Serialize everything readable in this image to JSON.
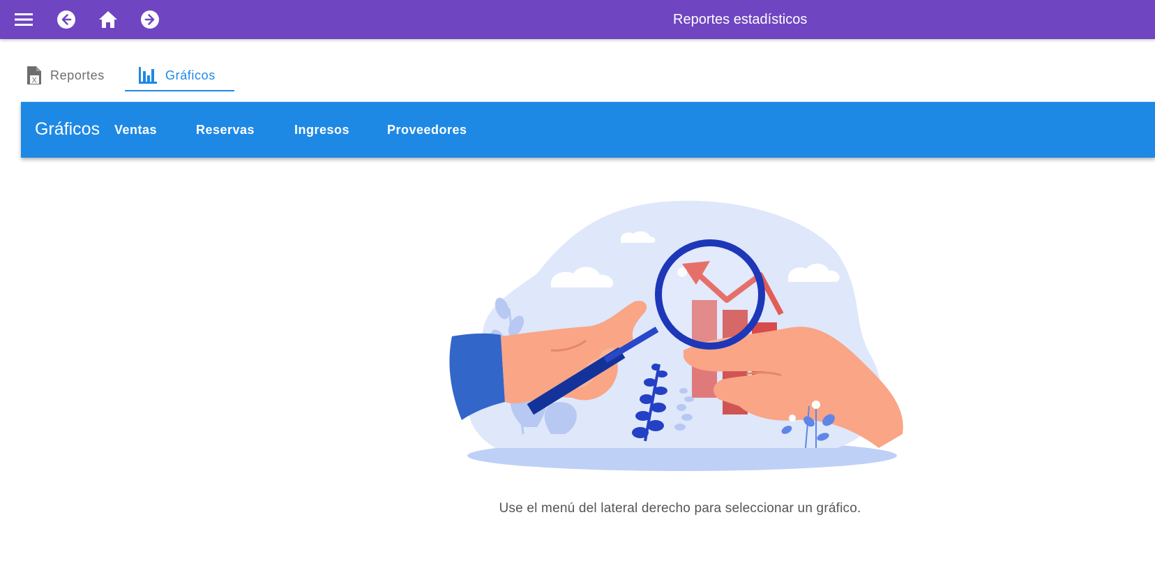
{
  "appbar": {
    "title": "Reportes estadísticos",
    "icons": [
      "menu-icon",
      "arrow-left-circle-icon",
      "home-icon",
      "arrow-right-circle-icon"
    ],
    "background": "#6f45c2"
  },
  "tabs": [
    {
      "label": "Reportes",
      "icon": "excel-file-icon",
      "active": false
    },
    {
      "label": "Gráficos",
      "icon": "bar-chart-icon",
      "active": true
    }
  ],
  "toolbar": {
    "brand": "Gráficos",
    "items": [
      "Ventas",
      "Reservas",
      "Ingresos",
      "Proveedores"
    ],
    "background": "#1e88e5"
  },
  "main": {
    "message": "Use el menú del lateral derecho para seleccionar un gráfico."
  }
}
